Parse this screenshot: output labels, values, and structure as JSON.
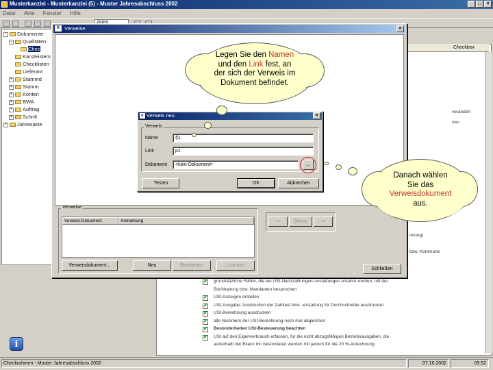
{
  "main_window": {
    "title": "Musterkanzlei - Musterkanzlei (5) - Muster Jahresabschluss 2002",
    "menu": [
      "Datei",
      "Akte",
      "Fenster",
      "Hilfe"
    ],
    "combo_value": "zoom"
  },
  "tree": {
    "items": [
      {
        "label": "Dokumente",
        "toggle": "-",
        "level": 0
      },
      {
        "label": "Qualitäten",
        "toggle": "-",
        "level": 1
      },
      {
        "label": "Chec",
        "toggle": "",
        "level": 2,
        "selected": true
      },
      {
        "label": "Kanzleistem",
        "toggle": "",
        "level": 1
      },
      {
        "label": "Checklisten",
        "toggle": "",
        "level": 1
      },
      {
        "label": "Lieferant",
        "toggle": "",
        "level": 1
      },
      {
        "label": "Stammd",
        "toggle": "+",
        "level": 1
      },
      {
        "label": "Stamm",
        "toggle": "+",
        "level": 1
      },
      {
        "label": "Konten",
        "toggle": "+",
        "level": 1
      },
      {
        "label": "BWA",
        "toggle": "+",
        "level": 1
      },
      {
        "label": "Auftrag",
        "toggle": "+",
        "level": 1
      },
      {
        "label": "Schrift",
        "toggle": "+",
        "level": 1
      },
      {
        "label": "Jahresakte",
        "toggle": "+",
        "level": 0
      }
    ]
  },
  "checklist": {
    "header": "Checkbox",
    "side_texts": [
      "verändert",
      "neu",
      "ierung)",
      "bzw. Kommune"
    ],
    "rows": [
      {
        "text": "grundsätzliche Fehler, die bei USt-Nachzahlungen/-erstattungen erkannt wurden, mit der",
        "bold": false,
        "checked": true
      },
      {
        "text": "Buchhaltung bzw. Mandanten besprochen",
        "bold": false,
        "checked": false
      },
      {
        "text": "USt-Anzeigen erstellen",
        "bold": false,
        "checked": true
      },
      {
        "text": "USt-Ausgabe: Ausdrucken der Zahllast bzw. -erstattung für Durchschreibe ausdrucken",
        "bold": false,
        "checked": true
      },
      {
        "text": "USt-Berechnung ausdrucken",
        "bold": false,
        "checked": true
      },
      {
        "text": "alle Nummern der USt-Berechnung noch mal abgleichen",
        "bold": false,
        "checked": true
      },
      {
        "text": "Besonderheiten USt-Besteuerung beachten",
        "bold": true,
        "checked": true
      },
      {
        "text": "USt auf den Eigenverbrauch erfassen, für die nicht abzugsfähigen Betriebsausgaben, die",
        "bold": false,
        "checked": true
      },
      {
        "text": "außerhalb der Bilanz ihn besonderen werden mit jedoch für die 20 %-Anrechnung",
        "bold": false,
        "checked": false
      }
    ]
  },
  "verweise_dialog": {
    "title": "Verweise",
    "group_label": "Verweise",
    "columns": [
      "Verweis-Dokument",
      "Anmerkung"
    ],
    "buttons": {
      "verweisdokument": "Verweisdokument...",
      "neu": "Neu",
      "bearbeiten": "Bearbeiten",
      "loeschen": "Löschen",
      "back": "⇦",
      "oeffnen": "Öffnen",
      "forward": "⇨",
      "schliessen": "Schließen"
    }
  },
  "verweis_dialog": {
    "title": "Verweis neu",
    "group_label": "Verweis",
    "fields": {
      "name_label": "Name",
      "name_value": "§1",
      "link_label": "Link",
      "link_value": "p1",
      "dokument_label": "Dokument",
      "dokument_value": "<kein Dokument>"
    },
    "buttons": {
      "browse": "...",
      "testen": "Testen",
      "ok": "OK",
      "abbrechen": "Abbrechen"
    }
  },
  "bubble_top": {
    "p1": "Legen Sie den ",
    "name": "Namen",
    "p2": "und den ",
    "link": "Link",
    "p3": " fest, an",
    "p4": "der sich der Verweis im",
    "p5": "Dokument befindet."
  },
  "bubble_right": {
    "line1": "Danach wählen",
    "line2": "Sie das",
    "highlight": "Verweisdokument",
    "line4": "aus."
  },
  "statusbar": {
    "main": "Checkrahmen - Muster Jahresabschluss 2002",
    "date": "07.10.2002",
    "time": "09:52"
  },
  "colors": {
    "title_blue": "#0a246a",
    "bubble_fill": "#ffffcc",
    "highlight_red": "#c0392b",
    "check_green": "#0a8a0a"
  }
}
